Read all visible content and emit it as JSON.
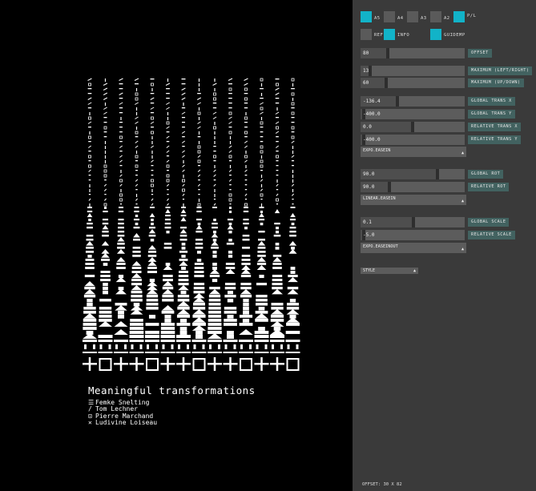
{
  "caption": {
    "title": "Meaningful transformations",
    "credits": [
      {
        "symbol": "☰",
        "symbol_icon": "three-lines-icon",
        "name": "Femke Snelting"
      },
      {
        "symbol": "/",
        "symbol_icon": "slash-icon",
        "name": "Tom Lechner"
      },
      {
        "symbol": "⊡",
        "symbol_icon": "boxed-dot-icon",
        "name": "Pierre Marchand"
      },
      {
        "symbol": "✕",
        "symbol_icon": "cross-icon",
        "name": "Ludivine Loiseau"
      }
    ]
  },
  "artwork": {
    "columns": 14,
    "fg": "#ffffff",
    "bg": "#000000"
  },
  "panel": {
    "accent": "#12b3c8",
    "label_bg": "#426260",
    "formats": [
      {
        "label": "A5",
        "on": true
      },
      {
        "label": "A4",
        "on": false
      },
      {
        "label": "A3",
        "on": false
      },
      {
        "label": "A2",
        "on": false
      },
      {
        "label": "P/L",
        "on": true
      }
    ],
    "modes": [
      {
        "label": "REF",
        "on": false
      },
      {
        "label": "INFO",
        "on": true
      },
      {
        "label": "GUIDEMP",
        "on": true
      }
    ],
    "offset": {
      "value": "80",
      "label": "offset"
    },
    "maximum_lr": {
      "value": "13",
      "label": "maximum (left/right)"
    },
    "maximum_ud": {
      "value": "60",
      "label": "maximum (up/down)"
    },
    "global_trans_x": {
      "value": "-136.4",
      "label": "global trans x"
    },
    "global_trans_y": {
      "value": "-400.0",
      "label": "global trans y"
    },
    "relative_trans_x": {
      "value": "0.0",
      "label": "relative trans x"
    },
    "relative_trans_y": {
      "value": "-400.0",
      "label": "relative trans y"
    },
    "easing_trans": {
      "value": "expo.easeIn"
    },
    "global_rot": {
      "value": "90.0",
      "label": "global rot"
    },
    "relative_rot": {
      "value": "90.0",
      "label": "relative rot"
    },
    "easing_rot": {
      "value": "linear.easeIn"
    },
    "global_scale": {
      "value": "0.1",
      "label": "global scale"
    },
    "relative_scale": {
      "value": "-5.0",
      "label": "relative scale"
    },
    "easing_scale": {
      "value": "expo.easeInOut"
    },
    "style": {
      "value": "style"
    },
    "status": "offset: 30 x 82"
  }
}
